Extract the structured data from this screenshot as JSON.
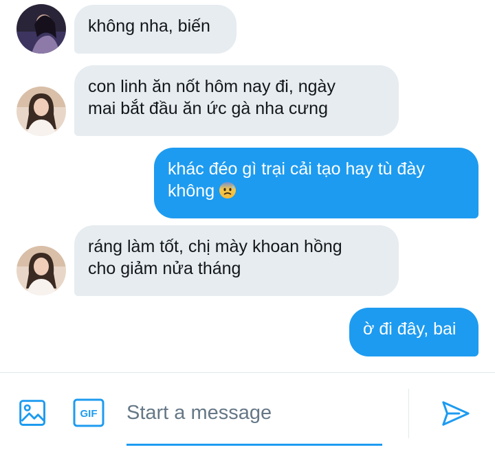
{
  "messages": [
    {
      "direction": "incoming",
      "lines": [
        "không nha, biến"
      ],
      "avatar": "avatar-dark-photo"
    },
    {
      "direction": "incoming",
      "lines": [
        "con linh ăn nốt hôm nay đi, ngày",
        "mai bắt đầu ăn ức gà nha cưng"
      ],
      "avatar": "avatar-light-photo"
    },
    {
      "direction": "outgoing",
      "lines": [
        "khác đéo gì trại cải tạo hay tù đày",
        "không"
      ],
      "emoji": "anxious-face-with-sweat-emoji"
    },
    {
      "direction": "incoming",
      "lines": [
        "ráng làm tốt, chị mày khoan hồng",
        "cho giảm nửa tháng"
      ],
      "avatar": "avatar-light-photo"
    },
    {
      "direction": "outgoing",
      "lines": [
        "ờ đi đây, bai"
      ]
    }
  ],
  "composer": {
    "placeholder": "Start a message",
    "value": "",
    "image_button": "image-icon",
    "gif_button": "GIF",
    "send_button": "send-icon"
  },
  "colors": {
    "accent": "#1d9bf0",
    "incoming_bubble": "#e6ecf0",
    "placeholder": "#657786"
  }
}
